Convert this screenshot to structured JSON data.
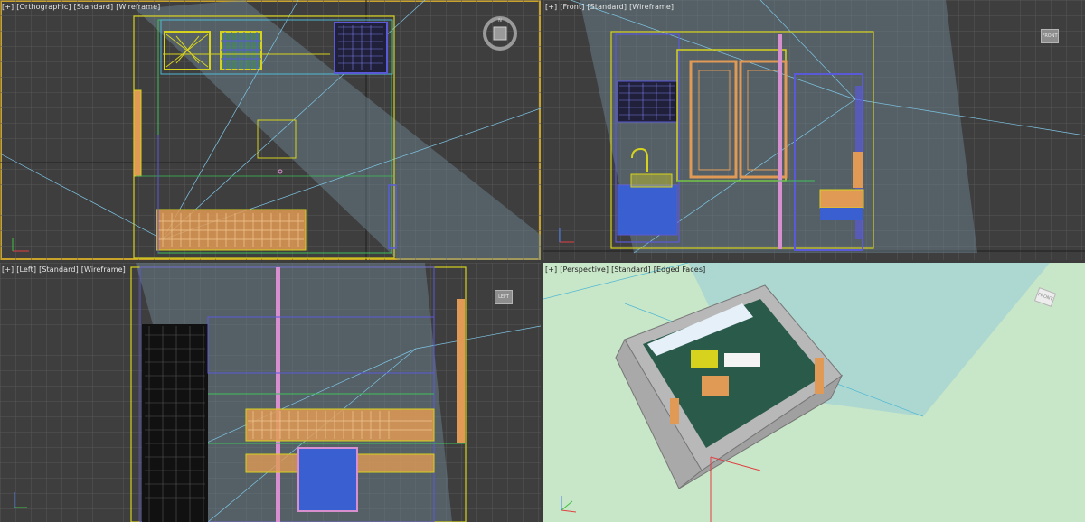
{
  "viewports": {
    "top": {
      "labels": [
        "[+]",
        "[Orthographic]",
        "[Standard]",
        "[Wireframe]"
      ],
      "viewcube": "compass-viewcube"
    },
    "front": {
      "labels": [
        "[+]",
        "[Front]",
        "[Standard]",
        "[Wireframe]"
      ],
      "viewcube_face": "FRONT"
    },
    "left": {
      "labels": [
        "[+]",
        "[Left]",
        "[Standard]",
        "[Wireframe]"
      ],
      "viewcube_face": "LEFT"
    },
    "perspective": {
      "labels": [
        "[+]",
        "[Perspective]",
        "[Standard]",
        "[Edged Faces]"
      ],
      "viewcube_face": "FRONT"
    }
  },
  "axes": {
    "x": "x",
    "y": "y",
    "z": "z"
  },
  "colors": {
    "viewport_bg": "#3e3e3e",
    "perspective_bg": "#c8e6c8",
    "grid": "#575757",
    "active_border": "#c9a22a",
    "cabinet_orange": "#e09a55",
    "wire_yellow": "#d6d21e",
    "wire_blue": "#5a5ad8",
    "wire_cyan": "#4fb7d4",
    "wire_pink": "#d88fd0",
    "wire_green": "#3fbf5a"
  }
}
